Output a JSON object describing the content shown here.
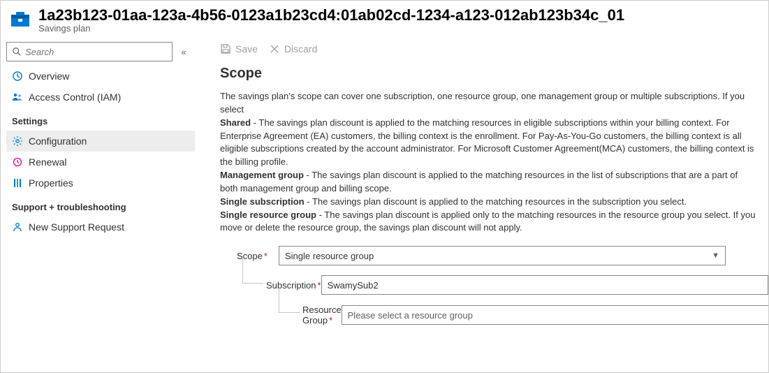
{
  "header": {
    "title": "1a23b123-01aa-123a-4b56-0123a1b23cd4:01ab02cd-1234-a123-012ab123b34c_01",
    "subtitle": "Savings plan"
  },
  "search": {
    "placeholder": "Search"
  },
  "nav": {
    "top": [
      {
        "label": "Overview"
      },
      {
        "label": "Access Control (IAM)"
      }
    ],
    "settingsLabel": "Settings",
    "settings": [
      {
        "label": "Configuration"
      },
      {
        "label": "Renewal"
      },
      {
        "label": "Properties"
      }
    ],
    "supportLabel": "Support + troubleshooting",
    "support": [
      {
        "label": "New Support Request"
      }
    ]
  },
  "toolbar": {
    "save": "Save",
    "discard": "Discard"
  },
  "main": {
    "heading": "Scope",
    "intro": "The savings plan's scope can cover one subscription, one resource group, one management group or multiple subscriptions. If you select",
    "shared_b": "Shared",
    "shared_t": " - The savings plan discount is applied to the matching resources in eligible subscriptions within your billing context. For Enterprise Agreement (EA) customers, the billing context is the enrollment. For Pay-As-You-Go customers, the billing context is all eligible subscriptions created by the account administrator. For Microsoft Customer Agreement(MCA) customers, the billing context is the billing profile.",
    "mg_b": "Management group",
    "mg_t": " - The savings plan discount is applied to the matching resources in the list of subscriptions that are a part of both management group and billing scope.",
    "ss_b": "Single subscription",
    "ss_t": " - The savings plan discount is applied to the matching resources in the subscription you select.",
    "srg_b": "Single resource group",
    "srg_t": " - The savings plan discount is applied only to the matching resources in the resource group you select. If you move or delete the resource group, the savings plan discount will not apply."
  },
  "form": {
    "scopeLabel": "Scope",
    "scopeValue": "Single resource group",
    "subLabel": "Subscription",
    "subValue": "SwamySub2",
    "rgLabel": "Resource Group",
    "rgPlaceholder": "Please select a resource group"
  }
}
